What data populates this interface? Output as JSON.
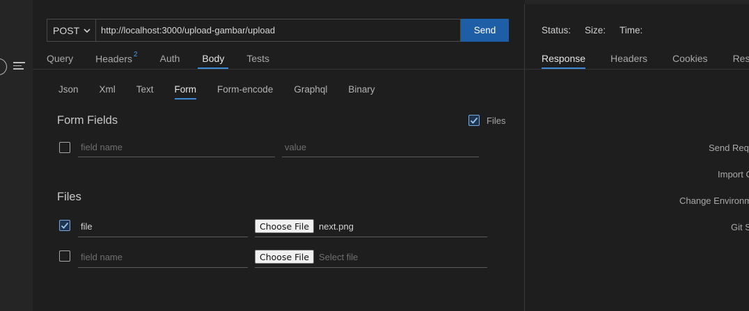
{
  "request": {
    "method": "POST",
    "url": "http://localhost:3000/upload-gambar/upload",
    "send_label": "Send",
    "tabs": [
      {
        "label": "Query",
        "badge": ""
      },
      {
        "label": "Headers",
        "badge": "2"
      },
      {
        "label": "Auth",
        "badge": ""
      },
      {
        "label": "Body",
        "badge": ""
      },
      {
        "label": "Tests",
        "badge": ""
      }
    ],
    "active_tab": "Body"
  },
  "body": {
    "tabs": [
      "Json",
      "Xml",
      "Text",
      "Form",
      "Form-encode",
      "Graphql",
      "Binary"
    ],
    "active_tab": "Form",
    "form_fields_title": "Form Fields",
    "files_toggle_label": "Files",
    "files_toggle_checked": true,
    "form_row": {
      "checked": false,
      "name_placeholder": "field name",
      "value_placeholder": "value"
    },
    "files_title": "Files",
    "file_rows": [
      {
        "checked": true,
        "name": "file",
        "choose_label": "Choose File",
        "file": "next.png"
      },
      {
        "checked": false,
        "name_placeholder": "field name",
        "choose_label": "Choose File",
        "file_placeholder": "Select file"
      }
    ]
  },
  "response": {
    "status_label": "Status:",
    "size_label": "Size:",
    "time_label": "Time:",
    "tabs": [
      "Response",
      "Headers",
      "Cookies",
      "Results"
    ],
    "active_tab": "Response",
    "shortcuts": [
      "Send Request",
      "Import Curl",
      "Change Environment",
      "Git Sync"
    ]
  },
  "colors": {
    "accent": "#3b8ad8",
    "send_button": "#1e5ea6",
    "background": "#1e1e1e"
  }
}
